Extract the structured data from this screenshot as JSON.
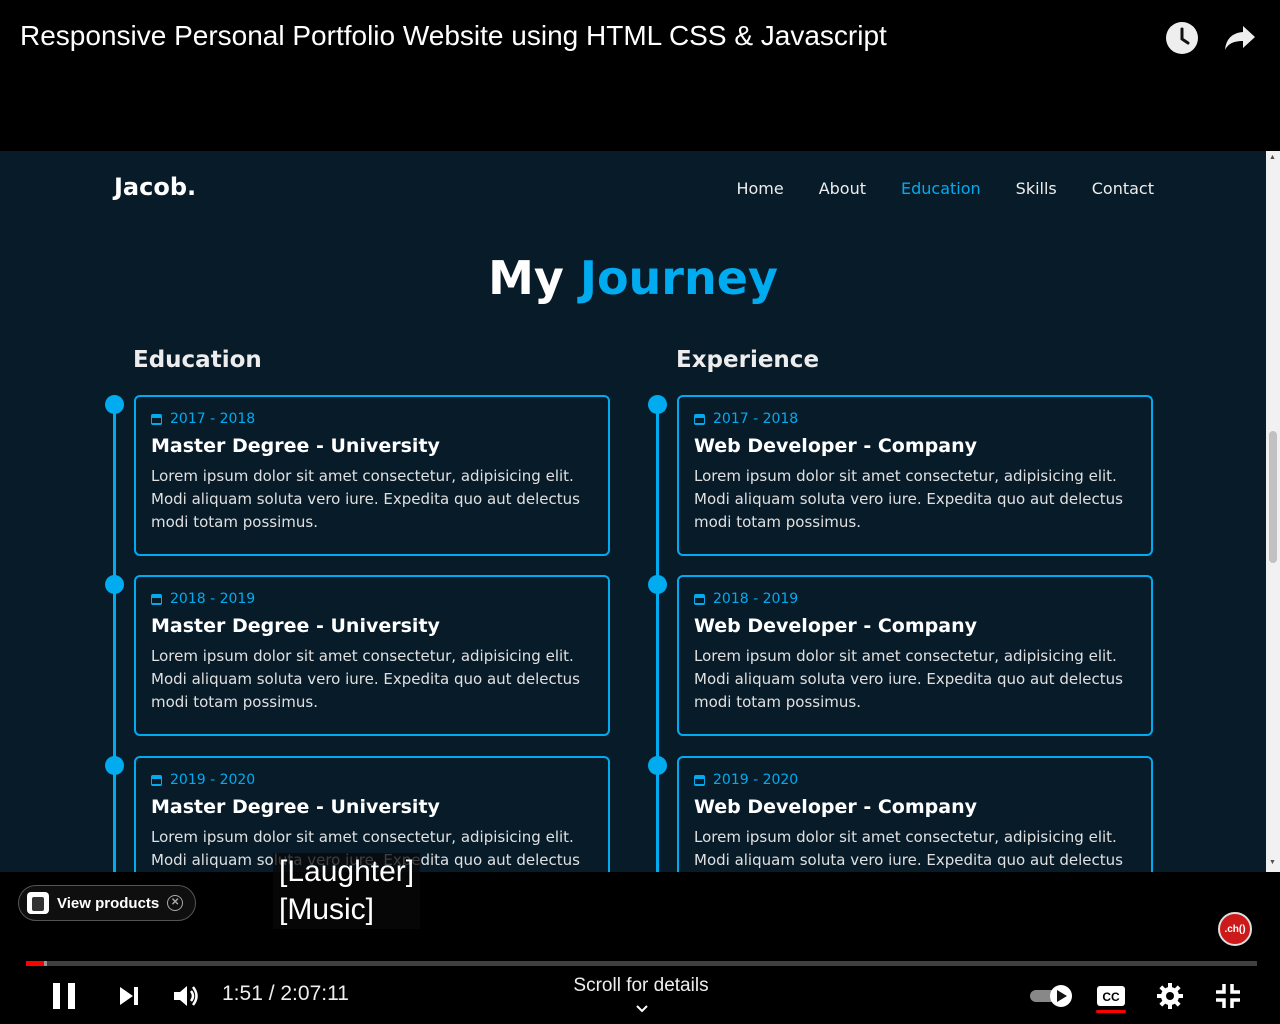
{
  "player": {
    "video_title": "Responsive Personal Portfolio Website using HTML CSS & Javascript",
    "captions": [
      "[Laughter]",
      "[Music]"
    ],
    "view_products_label": "View products",
    "time_display": "1:51 / 2:07:11",
    "scroll_hint": "Scroll for details",
    "progress_fraction": 0.0145,
    "buffered_fraction": 0.017,
    "subscribe_badge": ".ch()",
    "colors": {
      "progress": "#ff0000",
      "accent": "#00abf0",
      "site_bg": "#081b29"
    }
  },
  "site": {
    "logo": "Jacob.",
    "nav": [
      {
        "label": "Home",
        "active": false
      },
      {
        "label": "About",
        "active": false
      },
      {
        "label": "Education",
        "active": true
      },
      {
        "label": "Skills",
        "active": false
      },
      {
        "label": "Contact",
        "active": false
      }
    ],
    "heading_plain": "My",
    "heading_accent": "Journey",
    "education": {
      "title": "Education",
      "items": [
        {
          "date": "2017 - 2018",
          "title": "Master Degree - University",
          "desc": "Lorem ipsum dolor sit amet consectetur, adipisicing elit. Modi aliquam soluta vero iure. Expedita quo aut delectus modi totam possimus."
        },
        {
          "date": "2018 - 2019",
          "title": "Master Degree - University",
          "desc": "Lorem ipsum dolor sit amet consectetur, adipisicing elit. Modi aliquam soluta vero iure. Expedita quo aut delectus modi totam possimus."
        },
        {
          "date": "2019 - 2020",
          "title": "Master Degree - University",
          "desc": "Lorem ipsum dolor sit amet consectetur, adipisicing elit. Modi aliquam soluta vero iure. Expedita quo aut delectus"
        }
      ]
    },
    "experience": {
      "title": "Experience",
      "items": [
        {
          "date": "2017 - 2018",
          "title": "Web Developer - Company",
          "desc": "Lorem ipsum dolor sit amet consectetur, adipisicing elit. Modi aliquam soluta vero iure. Expedita quo aut delectus modi totam possimus."
        },
        {
          "date": "2018 - 2019",
          "title": "Web Developer - Company",
          "desc": "Lorem ipsum dolor sit amet consectetur, adipisicing elit. Modi aliquam soluta vero iure. Expedita quo aut delectus modi totam possimus."
        },
        {
          "date": "2019 - 2020",
          "title": "Web Developer - Company",
          "desc": "Lorem ipsum dolor sit amet consectetur, adipisicing elit. Modi aliquam soluta vero iure. Expedita quo aut delectus"
        }
      ]
    }
  }
}
